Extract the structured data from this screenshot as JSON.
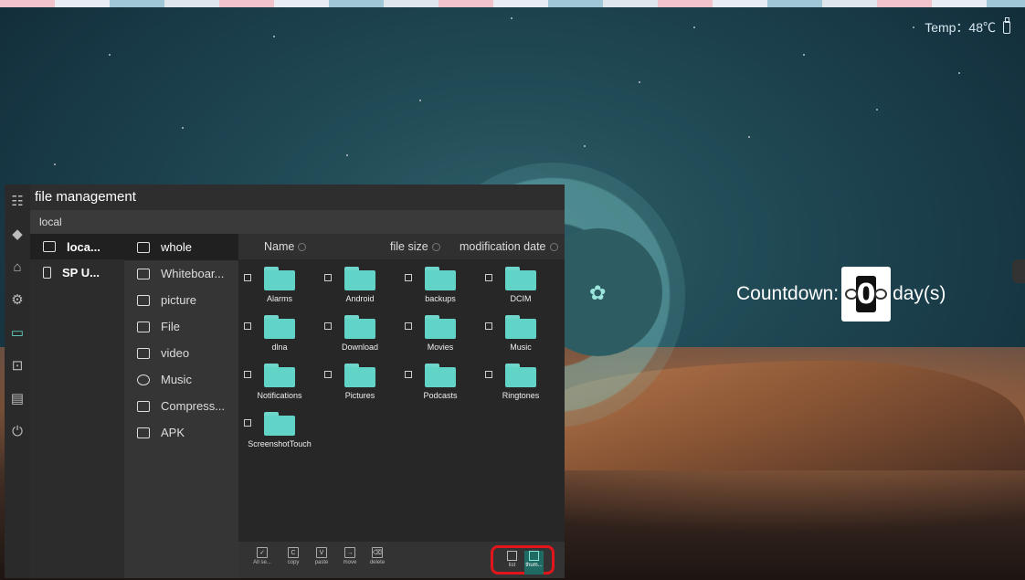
{
  "status": {
    "temp_label": "Temp：48℃"
  },
  "countdown": {
    "label": "Countdown:",
    "digit": "0",
    "unit": "day(s)"
  },
  "dock": {
    "items": [
      "apps-icon",
      "back-icon",
      "home-icon",
      "settings-icon",
      "folder-icon",
      "record-icon",
      "whiteboard-icon",
      "power-icon"
    ]
  },
  "file_manager": {
    "title": "file management",
    "breadcrumb": "local",
    "devices": [
      {
        "label": "loca...",
        "icon": "monitor-icon"
      },
      {
        "label": "SP U...",
        "icon": "usb-icon"
      }
    ],
    "categories": [
      {
        "label": "whole",
        "icon": "whole-icon"
      },
      {
        "label": "Whiteboar...",
        "icon": "whiteboard-icon"
      },
      {
        "label": "picture",
        "icon": "picture-icon"
      },
      {
        "label": "File",
        "icon": "file-icon"
      },
      {
        "label": "video",
        "icon": "video-icon"
      },
      {
        "label": "Music",
        "icon": "music-icon"
      },
      {
        "label": "Compress...",
        "icon": "compress-icon"
      },
      {
        "label": "APK",
        "icon": "apk-icon"
      }
    ],
    "columns": {
      "name": "Name",
      "size": "file size",
      "date": "modification date"
    },
    "folders": [
      "Alarms",
      "Android",
      "backups",
      "DCIM",
      "dlna",
      "Download",
      "Movies",
      "Music",
      "Notifications",
      "Pictures",
      "Podcasts",
      "Ringtones",
      "ScreenshotTouch"
    ],
    "toolbar": {
      "select_all": "All se...",
      "copy": "copy",
      "paste": "paste",
      "move": "move",
      "delete": "delete",
      "list": "list",
      "thumb": "thum..."
    }
  },
  "colors": {
    "accent": "#61d3c7",
    "highlight": "#e0161c"
  }
}
